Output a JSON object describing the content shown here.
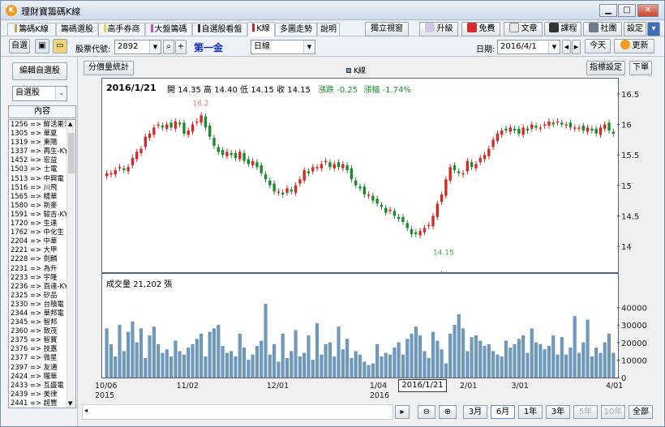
{
  "window": {
    "title": "理財寶籌碼K線",
    "logo": "K"
  },
  "tabs": [
    {
      "label": "籌碼K線",
      "mark": "#c9a64a"
    },
    {
      "label": "籌碼選股",
      "mark": ""
    },
    {
      "label": "高手券商",
      "mark": "#e7d24a"
    },
    {
      "label": "大盤籌碼",
      "mark": "#c24fd0"
    },
    {
      "label": "自選股看盤",
      "mark": "#333333"
    },
    {
      "label": "K線",
      "mark": "#cc2222"
    },
    {
      "label": "多圖走勢",
      "mark": ""
    },
    {
      "label": "說明",
      "mark": ""
    }
  ],
  "tab_buttons": {
    "standalone": "獨立視窗",
    "upgrade": "升級",
    "free": "免費",
    "article": "文章",
    "course": "課程",
    "community": "社團",
    "settings": "設定"
  },
  "toolbar": {
    "favorite": "自選",
    "stock_code_label": "股票代號:",
    "stock_code": "2892",
    "stock_name": "第一金",
    "period": "日線",
    "date_label": "日期:",
    "date": "2016/4/1",
    "today": "今天",
    "update": "更新"
  },
  "sidebar": {
    "edit_button": "編輯自選股",
    "group_select": "自選股",
    "header": "內容",
    "items": [
      "1256 => 鮮活果汁",
      "1305 => 華夏",
      "1319 => 東陽",
      "1337 => 再生-KY",
      "1452 => 宏益",
      "1503 => 士電",
      "1513 => 中興電",
      "1516 => 川飛",
      "1565 => 精華",
      "1580 => 新麥",
      "1591 => 駿吉-KY",
      "1720 => 生達",
      "1762 => 中化生",
      "2204 => 中華",
      "2221 => 大甲",
      "2228 => 劍麟",
      "2231 => 為升",
      "2233 => 宇隆",
      "2236 => 百達-KY",
      "2325 => 矽品",
      "2330 => 台積電",
      "2344 => 華邦電",
      "2345 => 智邦",
      "2360 => 致茂",
      "2375 => 智寶",
      "2376 => 技嘉",
      "2377 => 微星",
      "2397 => 友通",
      "2424 => 隴華",
      "2433 => 互盛電",
      "2439 => 美律",
      "2441 => 超豐"
    ]
  },
  "chart_header": {
    "volume_stats": "分價量統計",
    "legend": "K線",
    "indicator_settings": "指標設定",
    "close": "下單"
  },
  "price_info": {
    "date": "2016/1/21",
    "open_label": "開",
    "open": "14.35",
    "high_label": "高",
    "high": "14.40",
    "low_label": "低",
    "low": "14.15",
    "close_label": "收",
    "close": "14.15",
    "change_label": "漲跌",
    "change": "-0.25",
    "pct_label": "漲幅",
    "pct": "-1.74%"
  },
  "volume_info": {
    "label": "成交量",
    "value": "21,202",
    "unit": "張"
  },
  "cursor_label": "2016/1/21",
  "zoom": {
    "b3m": "3月",
    "b6m": "6月",
    "b1y": "1年",
    "b3y": "3年",
    "b5y": "5年",
    "b10y": "10年",
    "ball": "全部"
  },
  "colors": {
    "up": "#d42a2a",
    "down": "#1e8a2e",
    "volume": "#6f9ac0",
    "high_mark": "#e07a8a",
    "low_mark": "#4fa05f",
    "accent": "#1030c8"
  },
  "chart_data": {
    "type": "candlestick",
    "y_ticks": [
      "16.5",
      "16",
      "15.5",
      "15",
      "14.5",
      "14"
    ],
    "ylim": [
      13.6,
      16.7
    ],
    "vol_ticks": [
      "40000",
      "30000",
      "20000",
      "10000",
      "0"
    ],
    "vol_ylim": [
      0,
      44000
    ],
    "x_labels": [
      {
        "text": "10/06",
        "sub": "2015",
        "i": 0
      },
      {
        "text": "11/02",
        "sub": "",
        "i": 19
      },
      {
        "text": "12/01",
        "sub": "",
        "i": 40
      },
      {
        "text": "1/04",
        "sub": "2016",
        "i": 64
      },
      {
        "text": "2/01",
        "sub": "",
        "i": 85
      },
      {
        "text": "3/01",
        "sub": "",
        "i": 97
      },
      {
        "text": "4/01",
        "sub": "",
        "i": 119
      }
    ],
    "high_mark": {
      "label": "16.2",
      "i": 22,
      "value": 16.2
    },
    "low_mark": {
      "label": "14.15",
      "i": 78,
      "value": 14.15
    },
    "cursor_index": 78,
    "closes": [
      15.2,
      15.2,
      15.25,
      15.3,
      15.25,
      15.3,
      15.45,
      15.55,
      15.6,
      15.8,
      15.85,
      15.95,
      16.0,
      15.95,
      16.0,
      15.95,
      16.05,
      16.0,
      15.85,
      15.9,
      16.0,
      16.05,
      16.15,
      15.95,
      15.8,
      15.65,
      15.55,
      15.5,
      15.55,
      15.5,
      15.45,
      15.55,
      15.4,
      15.35,
      15.4,
      15.3,
      15.2,
      15.1,
      15.0,
      14.9,
      14.9,
      14.85,
      14.95,
      14.9,
      15.0,
      15.1,
      15.25,
      15.2,
      15.3,
      15.3,
      15.35,
      15.4,
      15.3,
      15.35,
      15.3,
      15.35,
      15.25,
      15.1,
      15.0,
      14.95,
      14.85,
      14.85,
      14.75,
      14.7,
      14.65,
      14.55,
      14.6,
      14.5,
      14.45,
      14.4,
      14.3,
      14.2,
      14.2,
      14.25,
      14.3,
      14.35,
      14.5,
      14.7,
      14.85,
      15.1,
      15.3,
      15.25,
      15.2,
      15.2,
      15.4,
      15.3,
      15.35,
      15.45,
      15.5,
      15.6,
      15.75,
      15.85,
      15.9,
      15.9,
      15.95,
      15.9,
      15.85,
      15.95,
      15.9,
      16.0,
      15.95,
      15.95,
      16.0,
      16.05,
      16.0,
      16.05,
      16.0,
      16.0,
      15.95,
      15.95,
      15.95,
      15.9,
      15.95,
      15.9,
      15.85,
      15.95,
      16.0,
      15.9,
      15.85
    ],
    "volumes": [
      28000,
      19000,
      12000,
      30000,
      15000,
      26000,
      32000,
      20000,
      28000,
      11000,
      24000,
      29000,
      19000,
      14000,
      16000,
      12000,
      21000,
      15000,
      13000,
      17000,
      19000,
      22000,
      25000,
      12000,
      26000,
      28000,
      30000,
      18000,
      14000,
      15000,
      12000,
      25000,
      17000,
      10000,
      13000,
      18000,
      21000,
      42000,
      13000,
      19000,
      9000,
      25000,
      11000,
      15000,
      27000,
      12000,
      14000,
      24000,
      10000,
      31000,
      13000,
      19000,
      20000,
      12000,
      29000,
      16000,
      22000,
      11000,
      15000,
      13000,
      9000,
      7000,
      8000,
      19000,
      12000,
      14000,
      13000,
      17000,
      20000,
      13000,
      22000,
      25000,
      29000,
      24000,
      15000,
      11000,
      26000,
      21000,
      16000,
      8000,
      25000,
      30000,
      36000,
      28000,
      15000,
      23000,
      24000,
      21000,
      18000,
      19000,
      15000,
      13000,
      12000,
      21000,
      17000,
      19000,
      22000,
      24000,
      14000,
      28000,
      20000,
      19000,
      16000,
      18000,
      24000,
      13000,
      23000,
      13000,
      17000,
      35000,
      14000,
      20000,
      33000,
      12000,
      17000,
      14000,
      20000,
      25000,
      14000
    ]
  }
}
